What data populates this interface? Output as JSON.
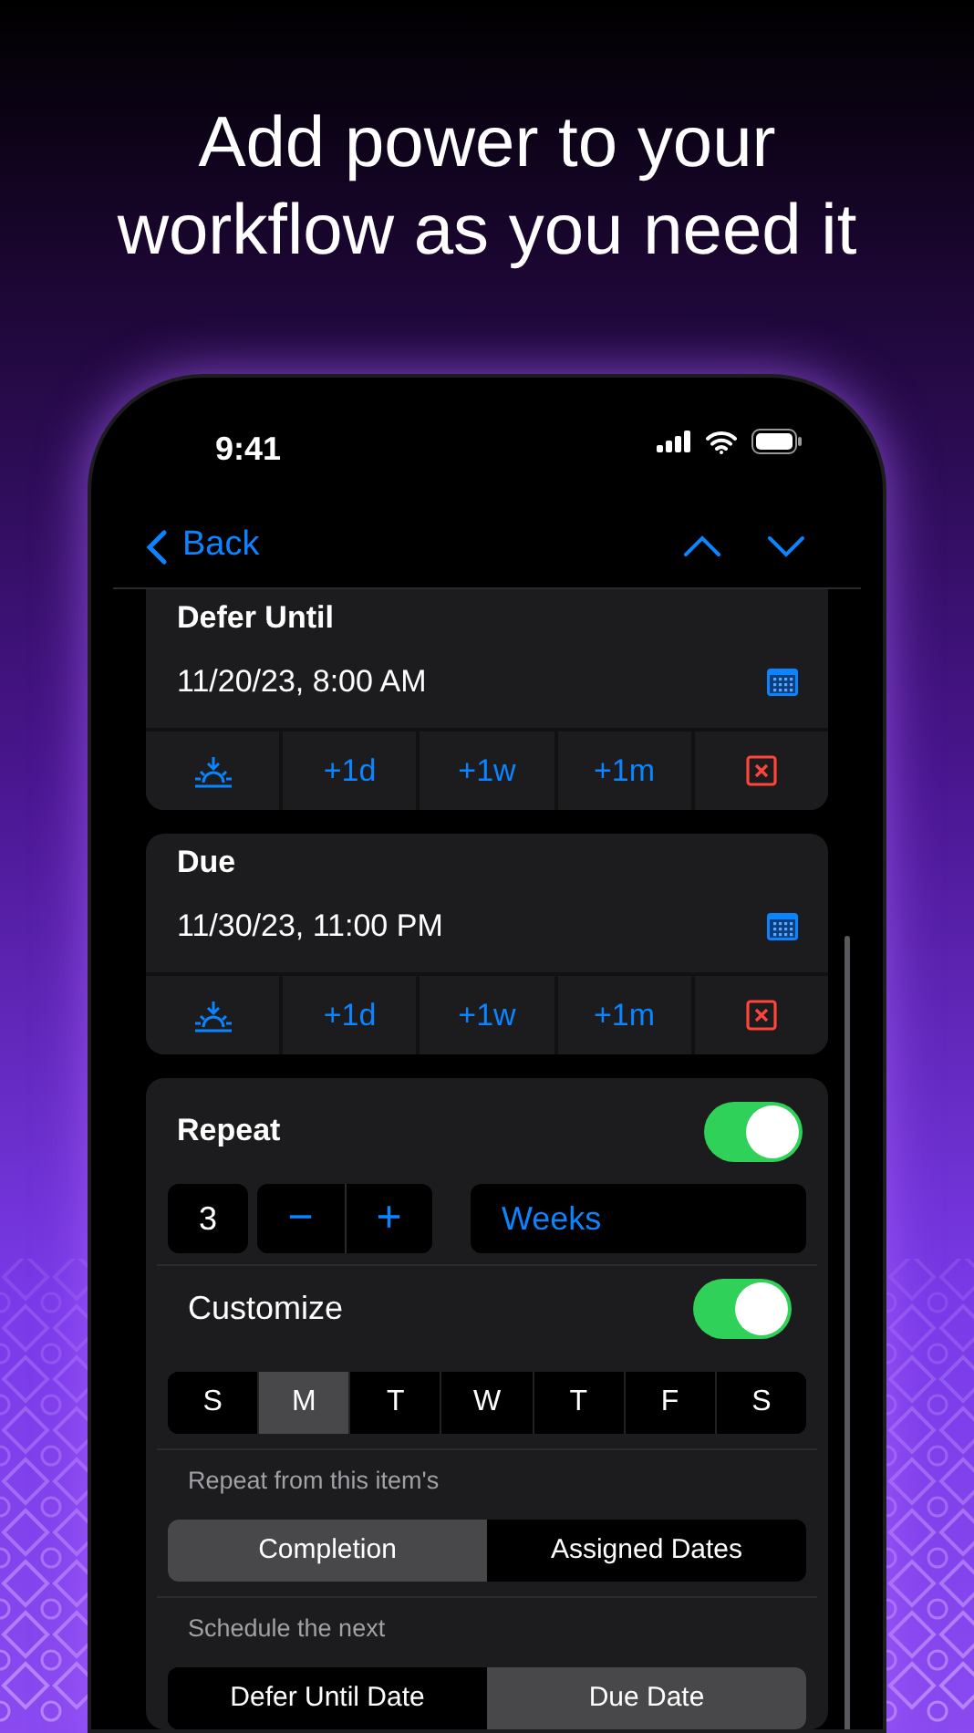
{
  "headline_lines": [
    "Add power to your",
    "workflow as you need it"
  ],
  "status_bar": {
    "time": "9:41"
  },
  "nav": {
    "back": "Back"
  },
  "date_sections": [
    {
      "title": "Defer Until",
      "value": "11/20/23, 8:00 AM",
      "quick_actions": [
        "+1d",
        "+1w",
        "+1m"
      ]
    },
    {
      "title": "Due",
      "value": "11/30/23, 11:00 PM",
      "quick_actions": [
        "+1d",
        "+1w",
        "+1m"
      ]
    }
  ],
  "repeat": {
    "label": "Repeat",
    "on": true,
    "count": "3",
    "stepper": [
      "−",
      "+"
    ],
    "unit": "Weeks",
    "customize": {
      "label": "Customize",
      "on": true
    },
    "weekdays": [
      {
        "label": "S",
        "selected": false
      },
      {
        "label": "M",
        "selected": true
      },
      {
        "label": "T",
        "selected": false
      },
      {
        "label": "W",
        "selected": false
      },
      {
        "label": "T",
        "selected": false
      },
      {
        "label": "F",
        "selected": false
      },
      {
        "label": "S",
        "selected": false
      }
    ],
    "repeat_from": {
      "label": "Repeat from this item's",
      "options": [
        {
          "label": "Completion",
          "selected": true
        },
        {
          "label": "Assigned Dates",
          "selected": false
        }
      ]
    },
    "schedule_next": {
      "label": "Schedule the next",
      "options": [
        {
          "label": "Defer Until Date",
          "selected": false
        },
        {
          "label": "Due Date",
          "selected": true
        }
      ]
    }
  }
}
